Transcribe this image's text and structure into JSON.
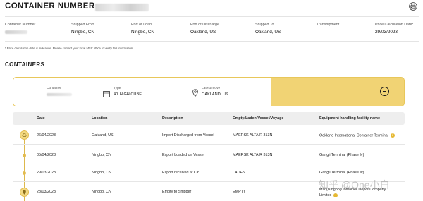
{
  "header": {
    "title": "CONTAINER NUMBER:",
    "print_icon": "print-icon"
  },
  "summary": {
    "fields": [
      {
        "label": "Container Number",
        "value": ""
      },
      {
        "label": "Shipped From",
        "value": "Ningbo, CN"
      },
      {
        "label": "Port of Load",
        "value": "Ningbo, CN"
      },
      {
        "label": "Port of Discharge",
        "value": "Oakland, US"
      },
      {
        "label": "Shipped To",
        "value": "Oakland, US"
      },
      {
        "label": "Transhipment",
        "value": ""
      },
      {
        "label": "Price Calculation Date*",
        "value": "29/03/2023"
      }
    ],
    "disclaimer": "* Price calculation date is indicative. Please contact your local MSC office to verify this information."
  },
  "containers": {
    "section_title": "CONTAINERS",
    "card": {
      "container_label": "Container",
      "container_value": "",
      "type_label": "Type",
      "type_value": "40' HIGH CUBE",
      "latest_move_label": "Latest move",
      "latest_move_value": "OAKLAND, US",
      "collapse_icon": "minus-circle-icon"
    },
    "columns": [
      "Date",
      "Location",
      "Description",
      "Empty/Laden/Vessel/Voyage",
      "Equipment handling facility name"
    ],
    "moves": [
      {
        "date": "26/04/2023",
        "location": "Oakland, US",
        "description": "Import Discharged from Vessel",
        "evv": "MAERSK ALTAIR 313N",
        "facility": "Oakland International Container Terminal",
        "info": true
      },
      {
        "date": "05/04/2023",
        "location": "Ningbo, CN",
        "description": "Export Loaded on Vessel",
        "evv": "MAERSK ALTAIR 313N",
        "facility": "Gangji Terminal (Phase Iv)",
        "info": false
      },
      {
        "date": "29/03/2023",
        "location": "Ningbo, CN",
        "description": "Export received at CY",
        "evv": "LADEN",
        "facility": "Gangji Terminal (Phase Iv)",
        "info": false
      },
      {
        "date": "28/03/2023",
        "location": "Ningbo, CN",
        "description": "Empty to Shipper",
        "evv": "EMPTY",
        "facility": "Msc(Ningbo)Container Depot Company Limited",
        "info": true
      }
    ]
  },
  "watermark": "知乎 @One小白",
  "colors": {
    "accent": "#f1d374",
    "accent_border": "#e2bb4e",
    "info_badge": "#e6b933"
  }
}
